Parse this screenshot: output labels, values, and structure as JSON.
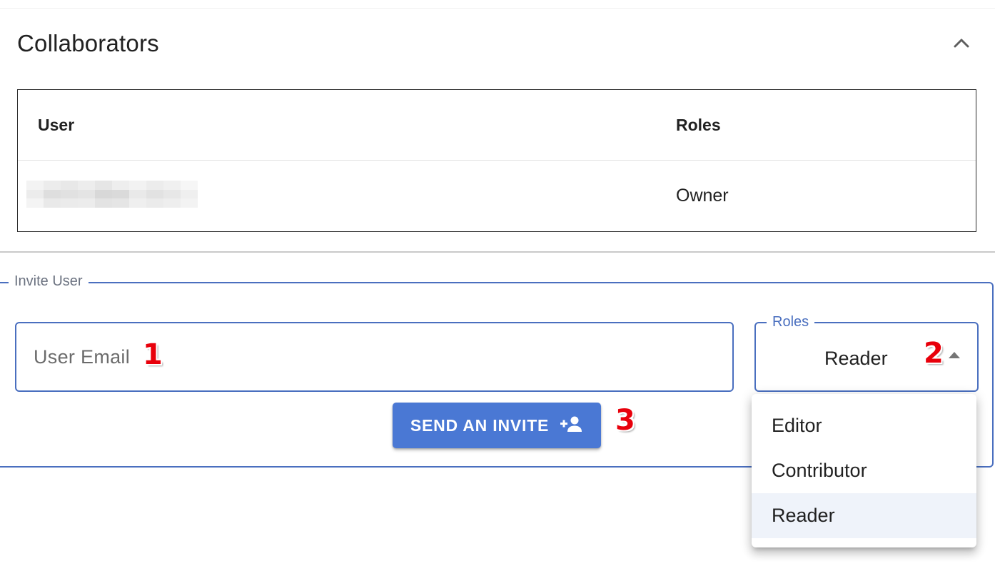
{
  "section": {
    "title": "Collaborators"
  },
  "table": {
    "headers": [
      "User",
      "Roles"
    ],
    "rows": [
      {
        "user": "",
        "role": "Owner"
      }
    ]
  },
  "invite": {
    "legend": "Invite User",
    "email_placeholder": "User Email",
    "roles_label": "Roles",
    "roles_value": "Reader",
    "send_label": "SEND AN INVITE",
    "role_options": [
      "Editor",
      "Contributor",
      "Reader"
    ],
    "selected_option": "Reader"
  },
  "annotations": [
    "1",
    "2",
    "3"
  ],
  "colors": {
    "accent": "#4a78d4",
    "border": "#4a6fbf",
    "annotation": "#e8000b"
  },
  "icons": {
    "collapse": "chevron-up-icon",
    "send": "person-add-icon",
    "dropdown": "caret-up-icon"
  }
}
